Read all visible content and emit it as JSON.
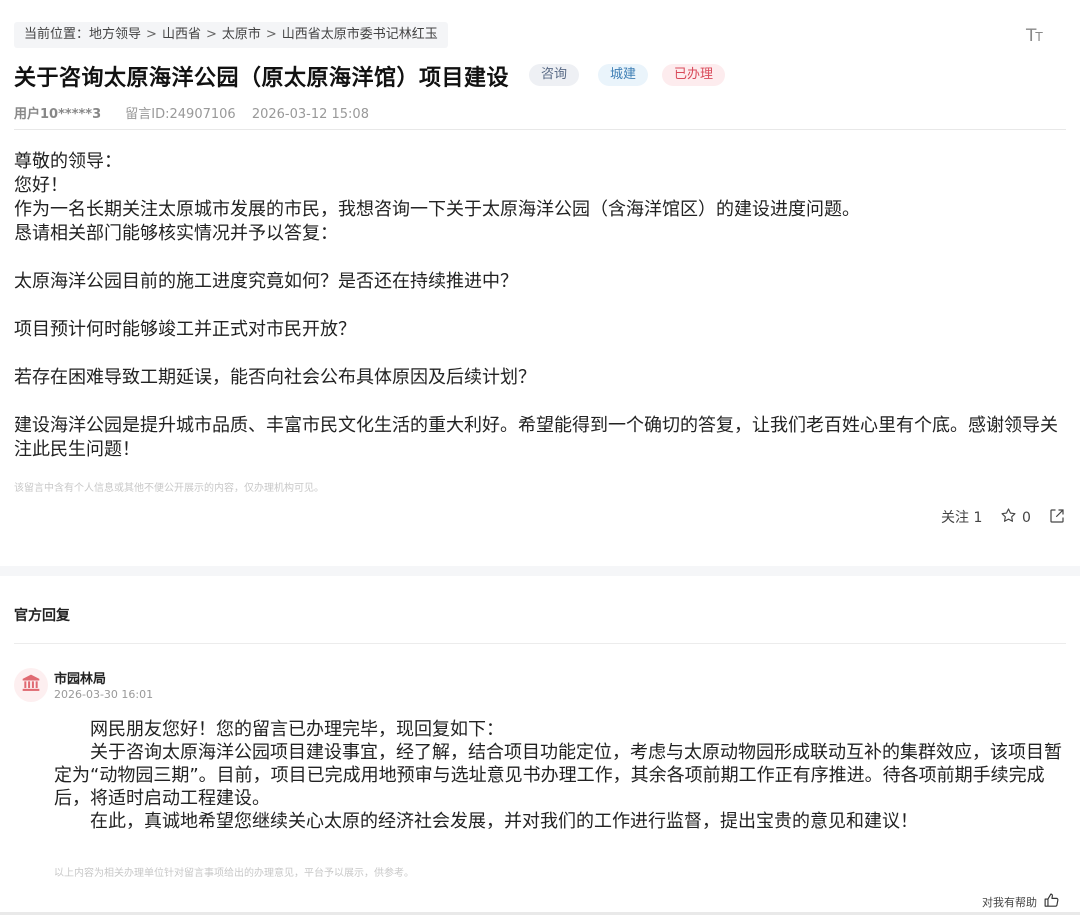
{
  "breadcrumb": {
    "prefix": "当前位置：",
    "items": [
      "地方领导",
      "山西省",
      "太原市",
      "山西省太原市委书记林红玉"
    ],
    "separator": ">"
  },
  "font_size_toggle": {
    "big": "T",
    "small": "T",
    "icon": "font-size-icon"
  },
  "message": {
    "title": "关于咨询太原海洋公园（原太原海洋馆）项目建设",
    "tags": [
      "咨询",
      "城建",
      "已办理"
    ],
    "user": "用户10*****3",
    "message_id": "留言ID:24907106",
    "datetime": "2026-03-12 15:08",
    "body": [
      "尊敬的领导：",
      "您好！",
      "作为一名长期关注太原城市发展的市民，我想咨询一下关于太原海洋公园（含海洋馆区）的建设进度问题。",
      "恳请相关部门能够核实情况并予以答复：",
      "太原海洋公园目前的施工进度究竟如何？是否还在持续推进中？",
      "项目预计何时能够竣工并正式对市民开放？",
      "若存在困难导致工期延误，能否向社会公布具体原因及后续计划？",
      "建设海洋公园是提升城市品质、丰富市民文化生活的重大利好。希望能得到一个确切的答复，让我们老百姓心里有个底。感谢领导关注此民生问题！"
    ],
    "privacy_note": "该留言中含有个人信息或其他不便公开展示的内容，仅办理机构可见。"
  },
  "actions": {
    "follow_label": "关注",
    "follow_count": "1",
    "star_count": "0",
    "star_icon": "star-icon",
    "share_icon": "share-icon"
  },
  "reply": {
    "heading": "官方回复",
    "department": "市园林局",
    "datetime": "2026-03-30 16:01",
    "paragraphs": [
      "网民朋友您好！您的留言已办理完毕，现回复如下：",
      "关于咨询太原海洋公园项目建设事宜，经了解，结合项目功能定位，考虑与太原动物园形成联动互补的集群效应，该项目暂定为“动物园三期”。目前，项目已完成用地预审与选址意见书办理工作，其余各项前期工作正有序推进。待各项前期手续完成后，将适时启动工程建设。",
      "在此，真诚地希望您继续关心太原的经济社会发展，并对我们的工作进行监督，提出宝贵的意见和建议！"
    ],
    "note": "以上内容为相关办理单位针对留言事项给出的办理意见，平台予以展示，供参考。",
    "helpful_label": "对我有帮助",
    "helpful_icon": "thumbs-up-icon",
    "dept_icon": "government-building-icon"
  },
  "colors": {
    "tag_consult": "#5a6b86",
    "tag_urban": "#3f7fb5",
    "tag_done": "#d94a5a",
    "dept_icon": "#e06a72"
  }
}
